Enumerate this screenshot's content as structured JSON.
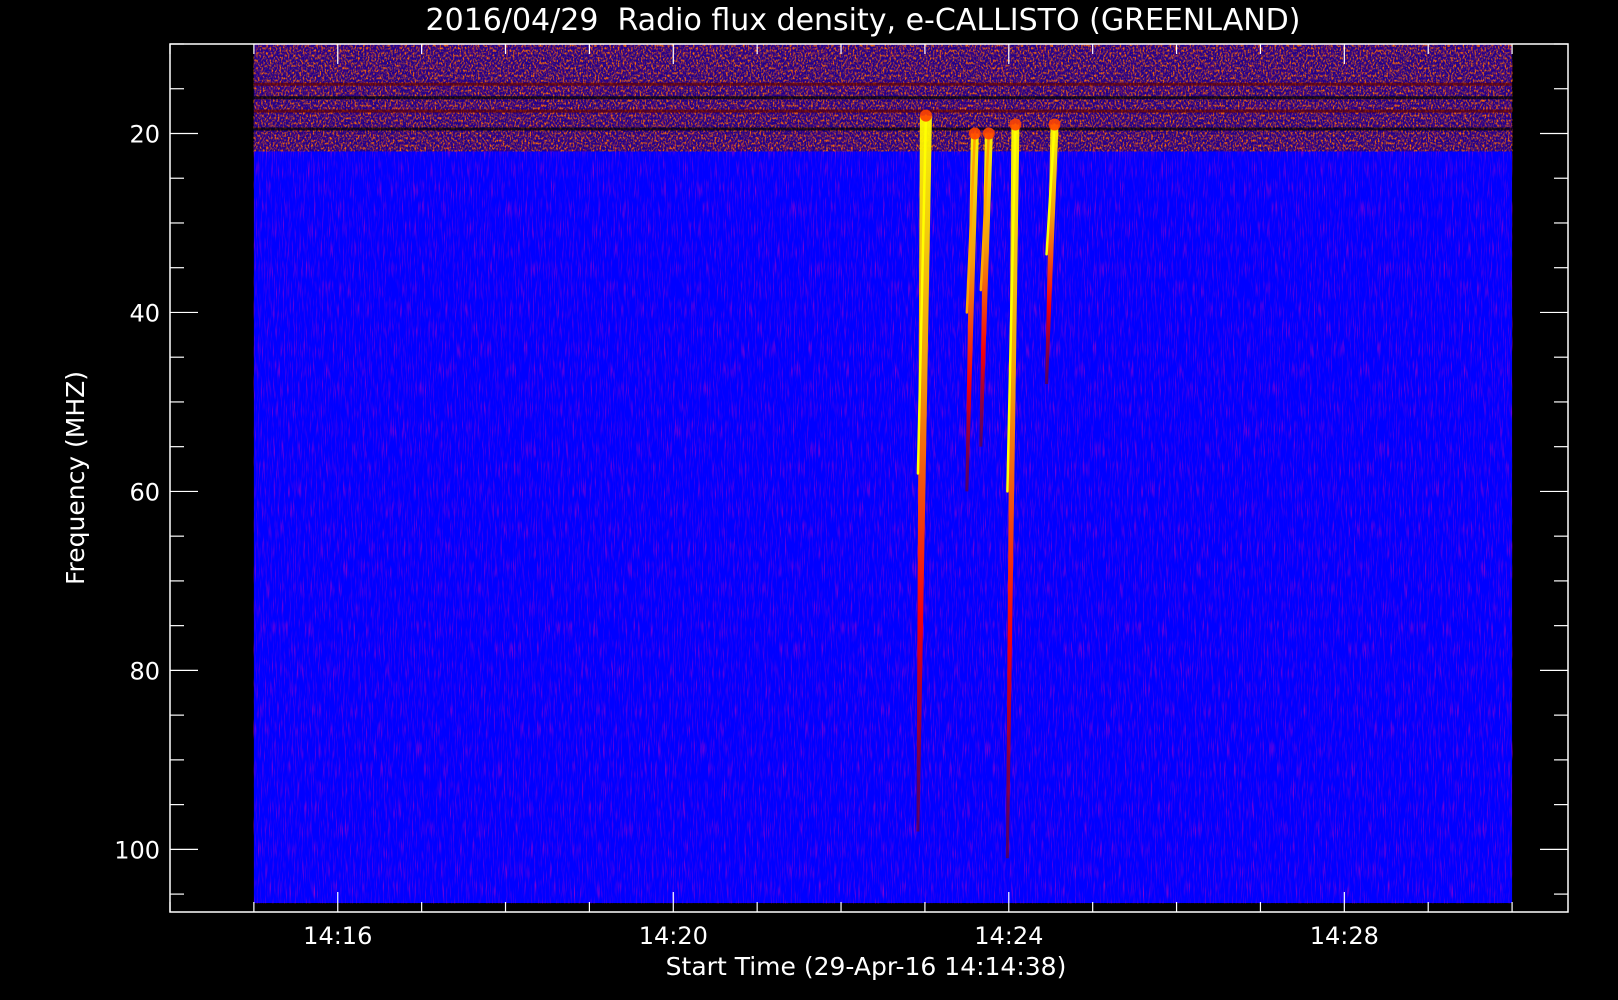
{
  "chart_data": {
    "type": "heatmap",
    "title": "2016/04/29  Radio flux density, e-CALLISTO (GREENLAND)",
    "xlabel": "Start Time (29-Apr-16 14:14:38)",
    "ylabel": "Frequency (MHZ)",
    "x_axis": {
      "unit": "time",
      "range": [
        "14:14:00",
        "14:30:40"
      ],
      "data_range": [
        "14:15:00",
        "14:30:00"
      ],
      "major_ticks": [
        "14:16",
        "14:20",
        "14:24",
        "14:28"
      ],
      "minor_tick_step_minutes": 1
    },
    "y_axis": {
      "unit": "MHz",
      "inverted": true,
      "range": [
        10,
        107
      ],
      "data_range": [
        10,
        106
      ],
      "major_ticks": [
        20,
        40,
        60,
        80,
        100
      ],
      "minor_tick_step": 5
    },
    "colormap": [
      "#0000ff",
      "#800000",
      "#ff0000",
      "#ffa500",
      "#ffff00"
    ],
    "background_colors": {
      "figure": "#000000",
      "axes_frame": "#ffffff",
      "plot_area": "#0000ff"
    },
    "interference_band_mhz": [
      10,
      22
    ],
    "events": [
      {
        "time": "14:22:55",
        "freq_start": 18,
        "freq_end": 98,
        "peak_color": "#ffff00"
      },
      {
        "time": "14:23:30",
        "freq_start": 20,
        "freq_end": 60,
        "peak_color": "#ffa500"
      },
      {
        "time": "14:23:40",
        "freq_start": 20,
        "freq_end": 55,
        "peak_color": "#ffa500"
      },
      {
        "time": "14:23:59",
        "freq_start": 19,
        "freq_end": 101,
        "peak_color": "#ffff00"
      },
      {
        "time": "14:24:27",
        "freq_start": 19,
        "freq_end": 48,
        "peak_color": "#ffff00"
      }
    ],
    "grid": false,
    "legend": "none"
  }
}
